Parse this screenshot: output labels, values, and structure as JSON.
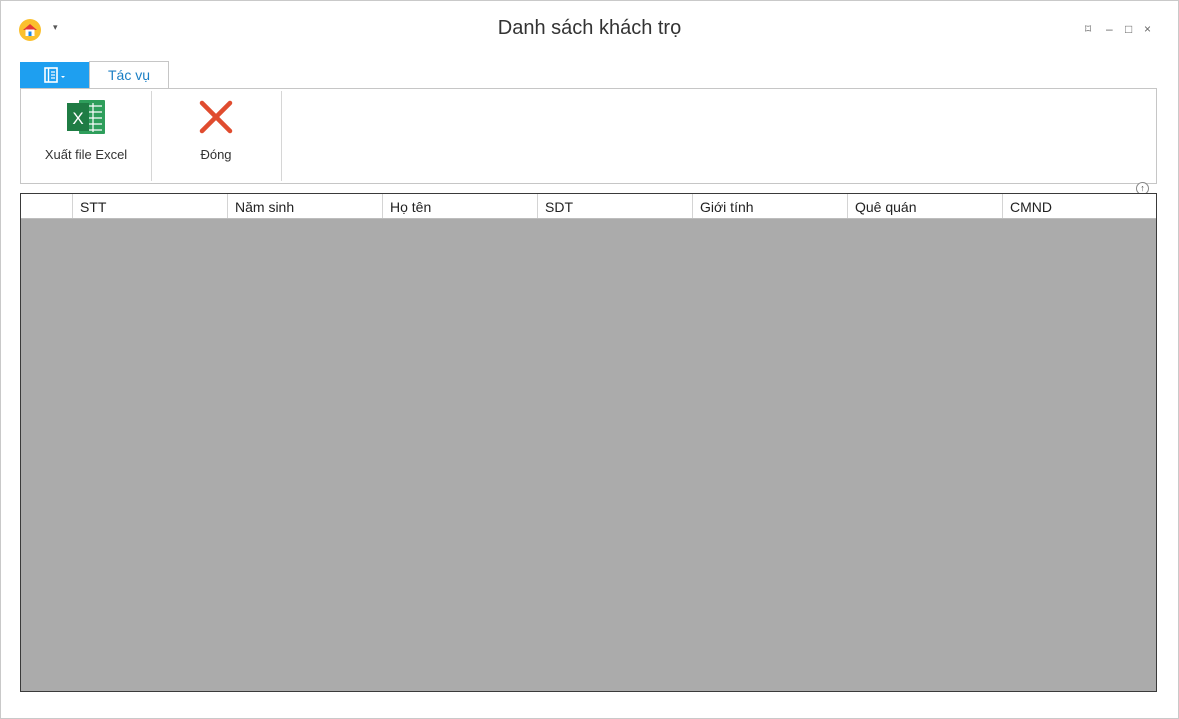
{
  "window": {
    "title": "Danh sách khách trọ",
    "qa_dropdown": "▾",
    "controls": {
      "restore": "⌑",
      "minimize": "–",
      "maximize": "□",
      "close": "×"
    }
  },
  "ribbon": {
    "tabs": [
      {
        "label": "Tác vụ"
      }
    ],
    "buttons": {
      "export_excel": "Xuất file Excel",
      "close": "Đóng"
    }
  },
  "grid": {
    "columns": [
      "STT",
      "Năm sinh",
      "Họ tên",
      "SDT",
      "Giới tính",
      "Quê quán",
      "CMND"
    ],
    "rows": []
  },
  "colors": {
    "accent": "#1e9ff0",
    "tab_text": "#1b7fc4",
    "grid_background": "#ababab",
    "excel_green": "#1f9d55",
    "close_red": "#e04c2f"
  },
  "icons": [
    "home-icon",
    "file-menu-icon",
    "excel-icon",
    "close-x-icon",
    "collapse-ribbon-icon"
  ]
}
